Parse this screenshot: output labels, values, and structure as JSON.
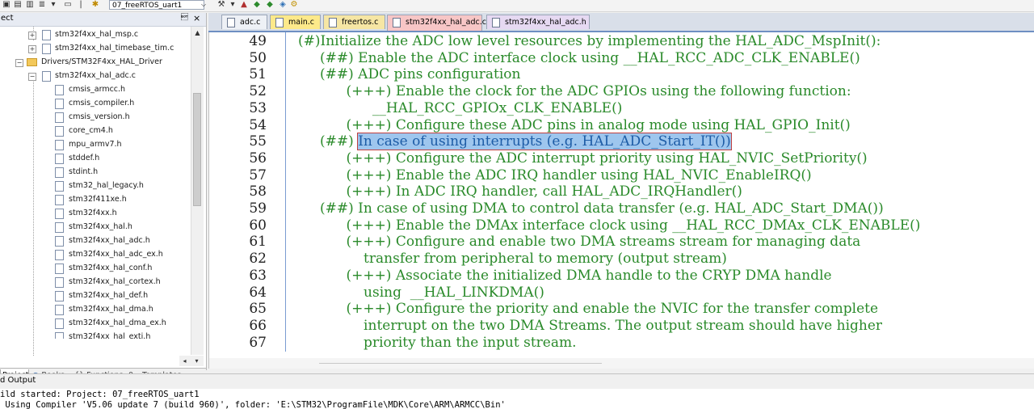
{
  "toolbar": {
    "target_name": "07_freeRTOS_uart1"
  },
  "project_panel": {
    "title": "ect",
    "pin": "\u0004",
    "close": "×"
  },
  "tree": {
    "items": [
      {
        "label": "stm32f4xx_hal_msp.c"
      },
      {
        "label": "stm32f4xx_hal_timebase_tim.c"
      },
      {
        "label": "Drivers/STM32F4xx_HAL_Driver"
      },
      {
        "label": "stm32f4xx_hal_adc.c"
      },
      {
        "label": "cmsis_armcc.h"
      },
      {
        "label": "cmsis_compiler.h"
      },
      {
        "label": "cmsis_version.h"
      },
      {
        "label": "core_cm4.h"
      },
      {
        "label": "mpu_armv7.h"
      },
      {
        "label": "stddef.h"
      },
      {
        "label": "stdint.h"
      },
      {
        "label": "stm32_hal_legacy.h"
      },
      {
        "label": "stm32f411xe.h"
      },
      {
        "label": "stm32f4xx.h"
      },
      {
        "label": "stm32f4xx_hal.h"
      },
      {
        "label": "stm32f4xx_hal_adc.h"
      },
      {
        "label": "stm32f4xx_hal_adc_ex.h"
      },
      {
        "label": "stm32f4xx_hal_conf.h"
      },
      {
        "label": "stm32f4xx_hal_cortex.h"
      },
      {
        "label": "stm32f4xx_hal_def.h"
      },
      {
        "label": "stm32f4xx_hal_dma.h"
      },
      {
        "label": "stm32f4xx_hal_dma_ex.h"
      },
      {
        "label": "stm32f4xx_hal_exti.h"
      }
    ]
  },
  "panel_tabs": {
    "project": "Project",
    "books": "Books",
    "functions": "{} Functions",
    "templates": "0→ Templates"
  },
  "editor_tabs": [
    {
      "label": "adc.c"
    },
    {
      "label": "main.c"
    },
    {
      "label": "freertos.c"
    },
    {
      "label": "stm32f4xx_hal_adc.c"
    },
    {
      "label": "stm32f4xx_hal_adc.h"
    }
  ],
  "editor": {
    "lines": [
      {
        "no": "49",
        "text": "(#)Initialize the ADC low level resources by implementing the HAL_ADC_MspInit():"
      },
      {
        "no": "50",
        "text": "     (##) Enable the ADC interface clock using __HAL_RCC_ADC_CLK_ENABLE()"
      },
      {
        "no": "51",
        "text": "     (##) ADC pins configuration"
      },
      {
        "no": "52",
        "text": "           (+++) Enable the clock for the ADC GPIOs using the following function:"
      },
      {
        "no": "53",
        "text": "                 __HAL_RCC_GPIOx_CLK_ENABLE()"
      },
      {
        "no": "54",
        "text": "           (+++) Configure these ADC pins in analog mode using HAL_GPIO_Init()"
      },
      {
        "no": "55",
        "prefix": "     (##) ",
        "highlight": "In case of using interrupts (e.g. HAL_ADC_Start_IT())"
      },
      {
        "no": "56",
        "text": "           (+++) Configure the ADC interrupt priority using HAL_NVIC_SetPriority()"
      },
      {
        "no": "57",
        "text": "           (+++) Enable the ADC IRQ handler using HAL_NVIC_EnableIRQ()"
      },
      {
        "no": "58",
        "text": "           (+++) In ADC IRQ handler, call HAL_ADC_IRQHandler()"
      },
      {
        "no": "59",
        "text": "     (##) In case of using DMA to control data transfer (e.g. HAL_ADC_Start_DMA())"
      },
      {
        "no": "60",
        "text": "           (+++) Enable the DMAx interface clock using __HAL_RCC_DMAx_CLK_ENABLE()"
      },
      {
        "no": "61",
        "text": "           (+++) Configure and enable two DMA streams stream for managing data"
      },
      {
        "no": "62",
        "text": "               transfer from peripheral to memory (output stream)"
      },
      {
        "no": "63",
        "text": "           (+++) Associate the initialized DMA handle to the CRYP DMA handle"
      },
      {
        "no": "64",
        "text": "               using  __HAL_LINKDMA()"
      },
      {
        "no": "65",
        "text": "           (+++) Configure the priority and enable the NVIC for the transfer complete"
      },
      {
        "no": "66",
        "text": "               interrupt on the two DMA Streams. The output stream should have higher"
      },
      {
        "no": "67",
        "text": "               priority than the input stream."
      }
    ]
  },
  "output": {
    "title": "d Output",
    "lines": [
      "ild started: Project: 07_freeRTOS_uart1",
      " Using Compiler 'V5.06 update 7 (build 960)', folder: 'E:\\STM32\\ProgramFile\\MDK\\Core\\ARM\\ARMCC\\Bin'"
    ]
  },
  "colors": {
    "comment_green": "#2a8a2a",
    "highlight_bg": "#9ec6ee",
    "highlight_text": "#1d5ca6",
    "tab_main": "#fde98a",
    "tab_freertos": "#f6e6a4",
    "tab_active": "#f7c6c6",
    "tab_h": "#e6d9f2"
  }
}
